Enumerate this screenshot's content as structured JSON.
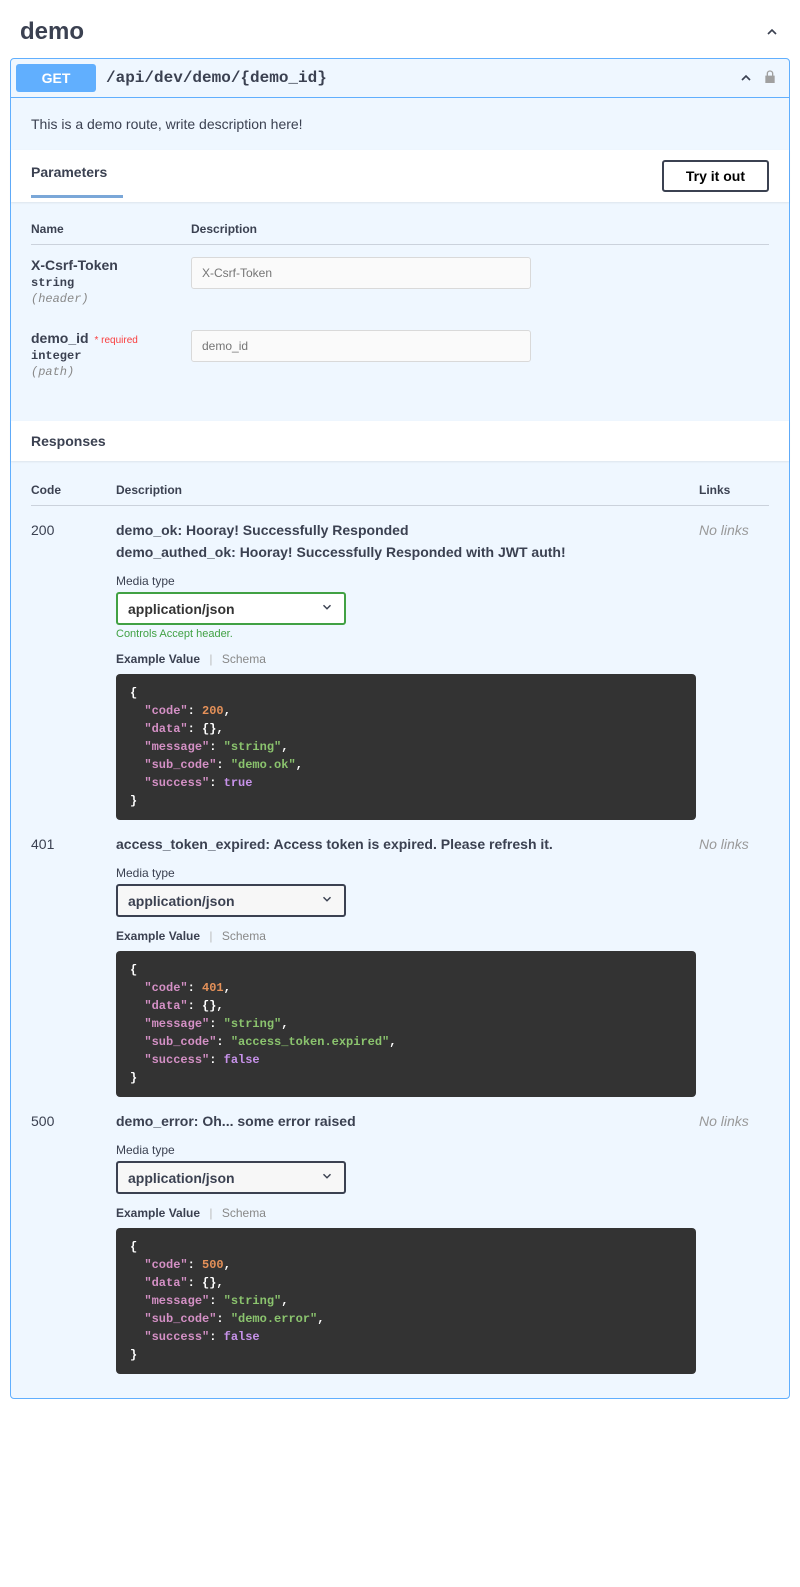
{
  "tag": {
    "name": "demo"
  },
  "endpoint": {
    "method": "GET",
    "path": "/api/dev/demo/{demo_id}",
    "description": "This is a demo route, write description here!"
  },
  "labels": {
    "parameters": "Parameters",
    "try_it_out": "Try it out",
    "name": "Name",
    "description": "Description",
    "responses": "Responses",
    "code": "Code",
    "links": "Links",
    "no_links": "No links",
    "media_type": "Media type",
    "controls_accept": "Controls Accept header.",
    "example_value": "Example Value",
    "schema": "Schema",
    "required": "required"
  },
  "parameters": [
    {
      "name": "X-Csrf-Token",
      "type": "string",
      "in": "(header)",
      "placeholder": "X-Csrf-Token",
      "required": false
    },
    {
      "name": "demo_id",
      "type": "integer",
      "in": "(path)",
      "placeholder": "demo_id",
      "required": true
    }
  ],
  "responses": [
    {
      "code": "200",
      "descriptions": [
        "demo_ok: Hooray! Successfully Responded",
        "demo_authed_ok: Hooray! Successfully Responded with JWT auth!"
      ],
      "media_type": "application/json",
      "green_select": true,
      "show_hint": true,
      "example": {
        "code": 200,
        "message": "string",
        "sub_code": "demo.ok",
        "success": true
      }
    },
    {
      "code": "401",
      "descriptions": [
        "access_token_expired: Access token is expired. Please refresh it."
      ],
      "media_type": "application/json",
      "green_select": false,
      "show_hint": false,
      "example": {
        "code": 401,
        "message": "string",
        "sub_code": "access_token.expired",
        "success": false
      }
    },
    {
      "code": "500",
      "descriptions": [
        "demo_error: Oh... some error raised"
      ],
      "media_type": "application/json",
      "green_select": false,
      "show_hint": false,
      "example": {
        "code": 500,
        "message": "string",
        "sub_code": "demo.error",
        "success": false
      }
    }
  ]
}
